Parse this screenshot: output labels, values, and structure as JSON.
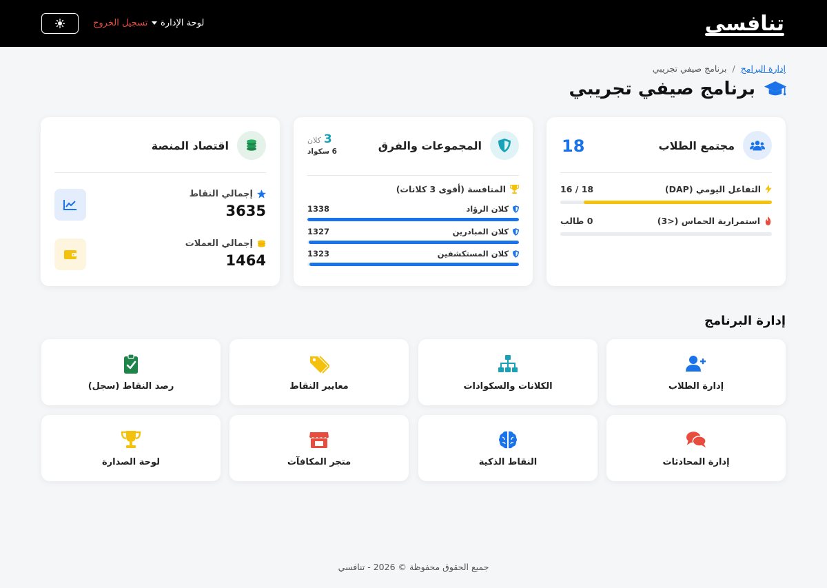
{
  "navbar": {
    "brand": "تنافسي",
    "dropdown_label": "لوحة الإدارة",
    "logout_label": "تسجيل الخروج",
    "theme_icon": "sun-icon"
  },
  "breadcrumb": {
    "parent": "إدارة البرامج",
    "separator": "/",
    "current": "برنامج صيفي تجريبي"
  },
  "page_title": "برنامج صيفي تجريبي",
  "students_card": {
    "title": "مجتمع الطلاب",
    "count": "18",
    "dap_label": "التفاعل اليومي (DAP)",
    "dap_value": "18 / 16",
    "dap_fraction": 0.889,
    "streak_label": "استمرارية الحماس (<3)",
    "streak_value": "0 طالب",
    "streak_fraction": 0
  },
  "groups_card": {
    "title": "المجموعات والفرق",
    "clan_count": "3",
    "clan_unit": "كلان",
    "squad_text": "6 سكواد",
    "competition_label": "المنافسة (أقوى 3 كلانات)",
    "clans": [
      {
        "name": "كلان الرؤاد",
        "points": "1338",
        "fraction": 1.0
      },
      {
        "name": "كلان المبادرين",
        "points": "1327",
        "fraction": 0.992
      },
      {
        "name": "كلان المستكشفين",
        "points": "1323",
        "fraction": 0.989
      }
    ]
  },
  "economy_card": {
    "title": "اقتصاد المنصة",
    "points_label": "إجمالي النقاط",
    "points_value": "3635",
    "coins_label": "إجمالي العملات",
    "coins_value": "1464"
  },
  "section_title": "إدارة البرنامج",
  "tiles": [
    {
      "label": "إدارة الطلاب",
      "icon": "user-plus-icon"
    },
    {
      "label": "الكلانات والسكوادات",
      "icon": "sitemap-icon"
    },
    {
      "label": "معايير النقاط",
      "icon": "tags-icon"
    },
    {
      "label": "رصد النقاط (سجل)",
      "icon": "clipboard-check-icon"
    },
    {
      "label": "إدارة المحادثات",
      "icon": "comments-icon"
    },
    {
      "label": "النقاط الذكية",
      "icon": "brain-icon"
    },
    {
      "label": "متجر المكافآت",
      "icon": "store-icon"
    },
    {
      "label": "لوحة الصدارة",
      "icon": "trophy-icon"
    }
  ],
  "colors": {
    "primary": "#1a73e8",
    "warning": "#f4c20d",
    "danger": "#e74c3c",
    "success": "#1e8449",
    "info": "#17a2b8"
  },
  "footer": "جميع الحقوق محفوظة © 2026 - تنافسي"
}
